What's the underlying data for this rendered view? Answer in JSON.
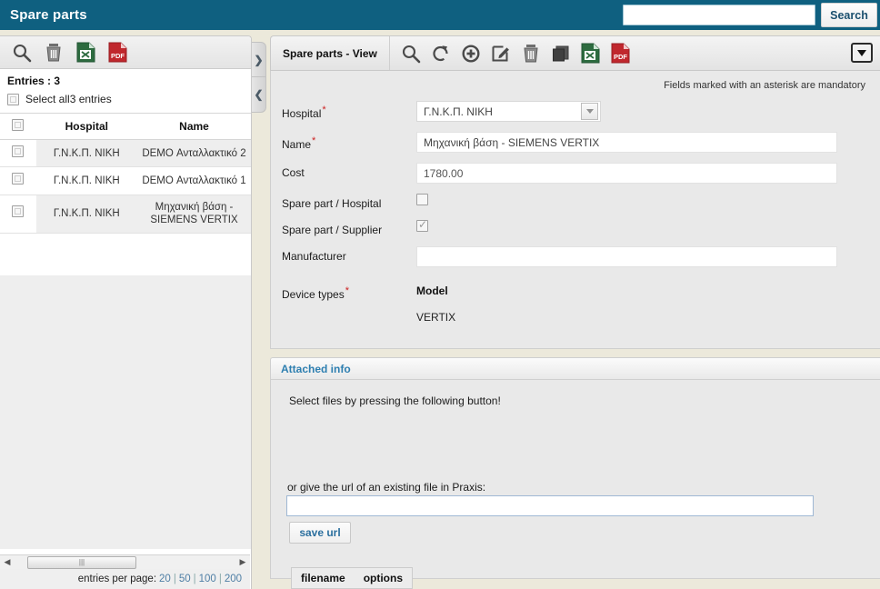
{
  "header": {
    "title": "Spare parts",
    "search_value": "",
    "search_placeholder": "",
    "search_button": "Search"
  },
  "left_panel": {
    "toolbar": [
      {
        "name": "search-icon",
        "label": "Search"
      },
      {
        "name": "delete-icon",
        "label": "Delete"
      },
      {
        "name": "excel-export-icon",
        "label": "Export to Excel"
      },
      {
        "name": "pdf-export-icon",
        "label": "Export to PDF"
      }
    ],
    "entries_label": "Entries : 3",
    "select_all_label": "Select all3 entries",
    "columns": [
      "Hospital",
      "Name"
    ],
    "rows": [
      {
        "hospital": "Γ.Ν.Κ.Π. ΝΙΚΗ",
        "name": "DEMO Ανταλλακτικό 2",
        "checked": false
      },
      {
        "hospital": "Γ.Ν.Κ.Π. ΝΙΚΗ",
        "name": "DEMO Ανταλλακτικό 1",
        "checked": false
      },
      {
        "hospital": "Γ.Ν.Κ.Π. ΝΙΚΗ",
        "name": "Μηχανική βάση - SIEMENS VERTIX",
        "checked": false
      }
    ],
    "per_page_label": "entries per page:",
    "per_page_options": [
      "20",
      "50",
      "100",
      "200"
    ],
    "collapse_expand_icon": "chevron-right-icon",
    "collapse_icon": "chevron-left-icon"
  },
  "right_panel": {
    "tab_label": "Spare parts - View",
    "tab_icons": [
      {
        "name": "search-icon"
      },
      {
        "name": "refresh-icon"
      },
      {
        "name": "add-icon"
      },
      {
        "name": "edit-icon"
      },
      {
        "name": "delete-icon"
      },
      {
        "name": "copy-icon"
      },
      {
        "name": "excel-export-icon"
      },
      {
        "name": "pdf-export-icon"
      }
    ],
    "dropdown_toggle_icon": "chevron-down-icon",
    "mandatory_note": "Fields marked with an asterisk are mandatory",
    "fields": {
      "hospital_label": "Hospital",
      "hospital_value": "Γ.Ν.Κ.Π. ΝΙΚΗ",
      "name_label": "Name",
      "name_value": "Μηχανική βάση - SIEMENS VERTIX",
      "cost_label": "Cost",
      "cost_value": "1780.00",
      "spare_hospital_label": "Spare part / Hospital",
      "spare_hospital_checked": false,
      "spare_supplier_label": "Spare part / Supplier",
      "spare_supplier_checked": true,
      "manufacturer_label": "Manufacturer",
      "manufacturer_value": "",
      "device_types_label": "Device types",
      "model_header": "Model",
      "model_value": "VERTIX"
    },
    "attached": {
      "title": "Attached info",
      "select_files_text": "Select files by pressing the following button!",
      "url_label": "or give the url of an existing file in Praxis:",
      "url_value": "",
      "save_url_button": "save url",
      "file_table_headers": [
        "filename",
        "options"
      ]
    }
  },
  "colors": {
    "brand": "#0f6080",
    "accent_link": "#2e7fb0",
    "asterisk": "#cc2222",
    "excel_green": "#2d6b3f",
    "pdf_red": "#c0272d"
  }
}
